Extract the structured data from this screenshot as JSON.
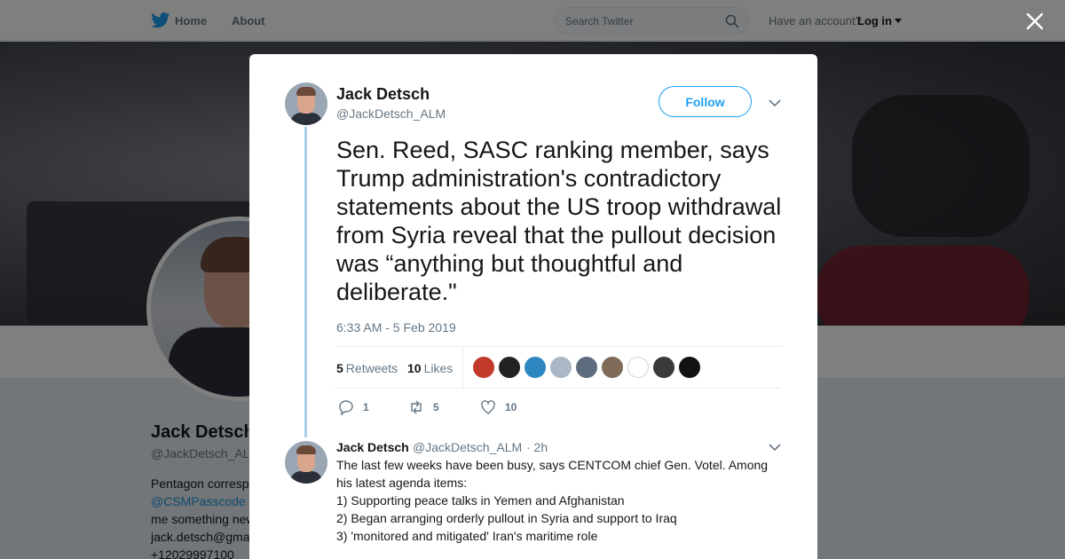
{
  "topnav": {
    "home_label": "Home",
    "about_label": "About",
    "search_placeholder": "Search Twitter",
    "account_text": "Have an account?",
    "login_label": "Log in"
  },
  "profile": {
    "name": "Jack Detsch",
    "handle": "@JackDetsch_ALM",
    "bio_lines": [
      "Pentagon correspondent",
      "@CSMPasscode",
      "me something new",
      "jack.detsch@gma",
      "+12029997100"
    ]
  },
  "tweet": {
    "author_name": "Jack Detsch",
    "author_handle": "@JackDetsch_ALM",
    "follow_label": "Follow",
    "text": "Sen. Reed, SASC ranking member, says Trump administration's contradictory statements about the US troop withdrawal from Syria reveal that the pullout decision was “anything but thoughtful and deliberate.\"",
    "timestamp": "6:33 AM - 5 Feb 2019",
    "retweet_count": "5",
    "retweet_label": "Retweets",
    "like_count": "10",
    "like_label": "Likes",
    "likers_colors": [
      "#c0392b",
      "#222222",
      "#2e86c1",
      "#aab7c4",
      "#5d6d7e",
      "#7f6b58",
      "#ffffff",
      "#3a3a3a",
      "#121212"
    ],
    "actions": {
      "reply_count": "1",
      "retweet_count": "5",
      "like_count": "10"
    }
  },
  "reply": {
    "author_name": "Jack Detsch",
    "author_handle": "@JackDetsch_ALM",
    "time": "· 2h",
    "lines": [
      "The last few weeks have been busy, says CENTCOM chief Gen. Votel. Among",
      "his latest agenda items:",
      "1) Supporting peace talks in Yemen and Afghanistan",
      "2) Began arranging orderly pullout in Syria and support to Iraq",
      "3) 'monitored and mitigated' Iran's maritime role"
    ]
  },
  "colors": {
    "accent": "#1da1f2",
    "link": "#1b95e0",
    "muted": "#657786",
    "thread_line": "#a6d2ec"
  }
}
